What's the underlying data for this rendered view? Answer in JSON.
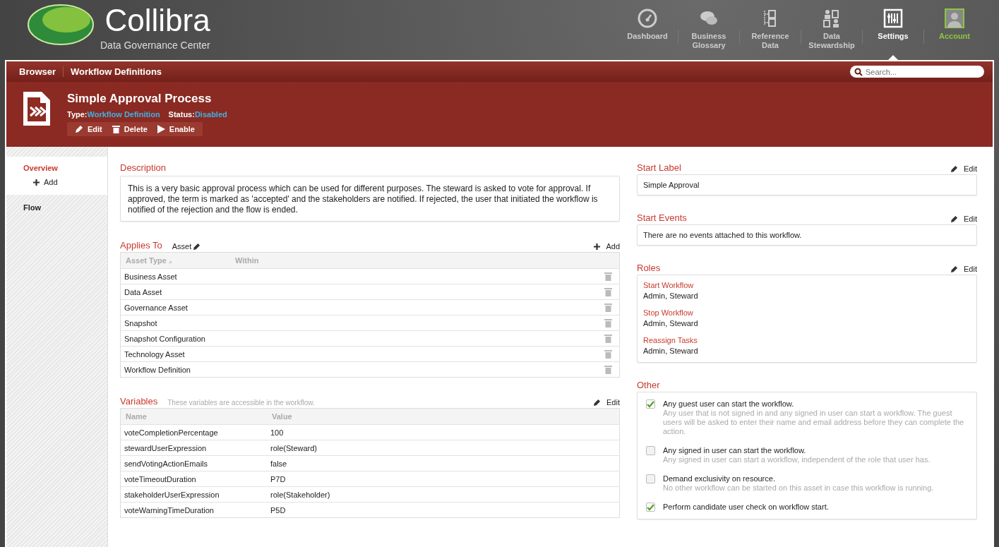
{
  "logo": {
    "name": "Collibra",
    "subtitle": "Data Governance Center"
  },
  "nav": [
    {
      "label": "Dashboard",
      "selected": false,
      "kind": "plain"
    },
    {
      "label": "Business Glossary",
      "selected": false,
      "kind": "plain"
    },
    {
      "label": "Reference Data",
      "selected": false,
      "kind": "plain"
    },
    {
      "label": "Data Stewardship",
      "selected": false,
      "kind": "plain"
    },
    {
      "label": "Settings",
      "selected": true,
      "kind": "plain"
    },
    {
      "label": "Account",
      "selected": false,
      "kind": "account"
    }
  ],
  "breadcrumb": [
    "Browser",
    "Workflow Definitions"
  ],
  "search": {
    "placeholder": "Search..."
  },
  "header": {
    "title": "Simple Approval Process",
    "type_label": "Type:",
    "type_value": "Workflow Definition",
    "status_label": "Status:",
    "status_value": "Disabled",
    "actions": [
      "Edit",
      "Delete",
      "Enable"
    ]
  },
  "sidebar": [
    {
      "label": "Overview",
      "selected": true,
      "children": [
        {
          "label": "Add"
        }
      ]
    },
    {
      "label": "Flow",
      "selected": false
    }
  ],
  "description": {
    "title": "Description",
    "text": "This is a very basic approval process which can be used for different purposes. The steward is asked to vote for approval. If approved, the term is marked as 'accepted' and the stakeholders are notified. If rejected, the user that initiated the workflow is notified of the rejection and the flow is ended."
  },
  "applies_to": {
    "title": "Applies To",
    "tag": "Asset",
    "add": "Add",
    "columns": [
      "Asset Type",
      "Within"
    ],
    "rows": [
      "Business Asset",
      "Data Asset",
      "Governance Asset",
      "Snapshot",
      "Snapshot Configuration",
      "Technology Asset",
      "Workflow Definition"
    ]
  },
  "variables": {
    "title": "Variables",
    "hint": "These variables are accessible in the workflow.",
    "edit": "Edit",
    "columns": [
      "Name",
      "Value"
    ],
    "rows": [
      [
        "voteCompletionPercentage",
        "100"
      ],
      [
        "stewardUserExpression",
        "role(Steward)"
      ],
      [
        "sendVotingActionEmails",
        "false"
      ],
      [
        "voteTimeoutDuration",
        "P7D"
      ],
      [
        "stakeholderUserExpression",
        "role(Stakeholder)"
      ],
      [
        "voteWarningTimeDuration",
        "P5D"
      ]
    ]
  },
  "start_label": {
    "title": "Start Label",
    "edit": "Edit",
    "value": "Simple Approval"
  },
  "start_events": {
    "title": "Start Events",
    "edit": "Edit",
    "value": "There are no events attached to this workflow."
  },
  "roles": {
    "title": "Roles",
    "edit": "Edit",
    "items": [
      {
        "name": "Start Workflow",
        "value": "Admin, Steward"
      },
      {
        "name": "Stop Workflow",
        "value": "Admin, Steward"
      },
      {
        "name": "Reassign Tasks",
        "value": "Admin, Steward"
      }
    ]
  },
  "other": {
    "title": "Other",
    "options": [
      {
        "label": "Any guest user can start the workflow.",
        "note": "Any user that is not signed in and any signed in user can start a workflow. The guest users will be asked to enter their name and email address before they can complete the action.",
        "checked": true
      },
      {
        "label": "Any signed in user can start the workflow.",
        "note": "Any signed in user can start a workflow, independent of the role that user has.",
        "checked": false
      },
      {
        "label": "Demand exclusivity on resource.",
        "note": "No other workflow can be started on this asset in case this workflow is running.",
        "checked": false
      },
      {
        "label": "Perform candidate user check on workflow start.",
        "checked": true
      }
    ]
  }
}
